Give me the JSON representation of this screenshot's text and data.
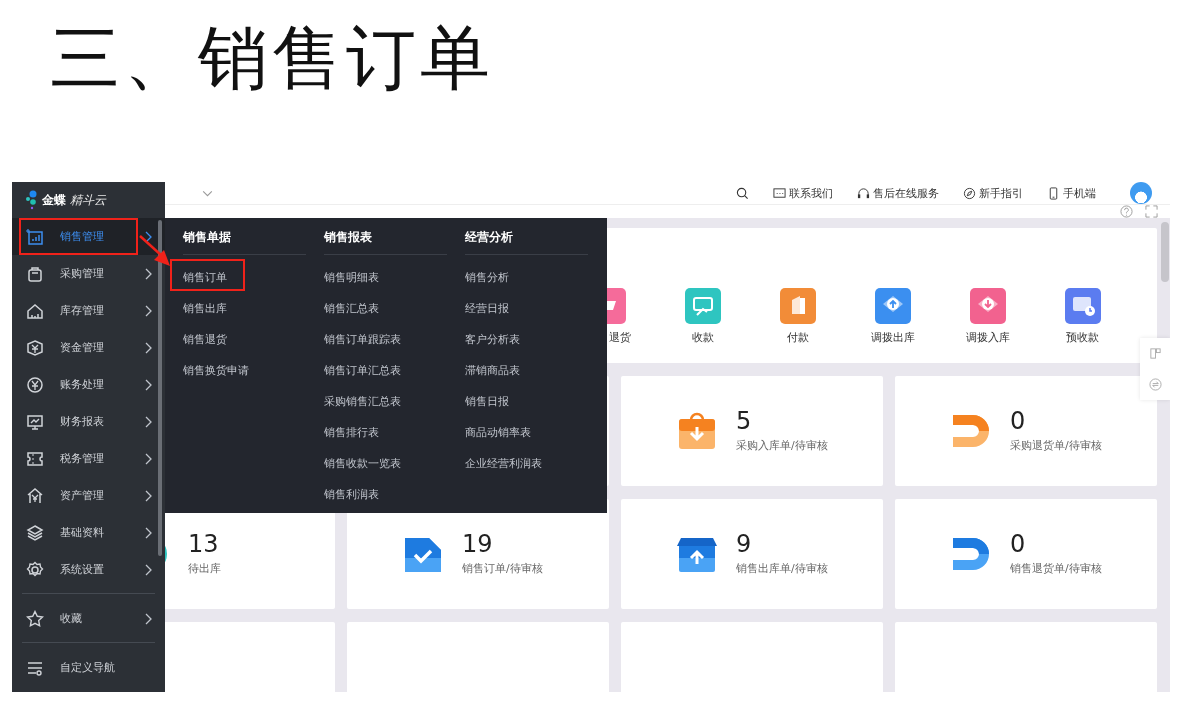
{
  "slide_title": "三、销售订单",
  "app": {
    "logo_brand": "金蝶",
    "logo_product": "精斗云",
    "header_links": [
      {
        "label": "联系我们"
      },
      {
        "label": "售后在线服务"
      },
      {
        "label": "新手指引"
      },
      {
        "label": "手机端"
      }
    ],
    "sidebar": {
      "items": [
        {
          "label": "销售管理",
          "selected": true,
          "annotated": true
        },
        {
          "label": "采购管理",
          "selected": false,
          "annotated": false
        },
        {
          "label": "库存管理",
          "selected": false,
          "annotated": false
        },
        {
          "label": "资金管理",
          "selected": false,
          "annotated": false
        },
        {
          "label": "账务处理",
          "selected": false,
          "annotated": false
        },
        {
          "label": "财务报表",
          "selected": false,
          "annotated": false
        },
        {
          "label": "税务管理",
          "selected": false,
          "annotated": false
        },
        {
          "label": "资产管理",
          "selected": false,
          "annotated": false
        },
        {
          "label": "基础资料",
          "selected": false,
          "annotated": false
        },
        {
          "label": "系统设置",
          "selected": false,
          "annotated": false
        }
      ],
      "favorites": {
        "label": "收藏"
      },
      "custom_nav": {
        "label": "自定义导航"
      }
    },
    "mega_menu": {
      "columns": [
        {
          "title": "销售单据",
          "items": [
            {
              "label": "销售订单",
              "annotated": true
            },
            {
              "label": "销售出库",
              "annotated": false
            },
            {
              "label": "销售退货",
              "annotated": false
            },
            {
              "label": "销售换货申请",
              "annotated": false
            }
          ]
        },
        {
          "title": "销售报表",
          "items": [
            {
              "label": "销售明细表",
              "annotated": false
            },
            {
              "label": "销售汇总表",
              "annotated": false
            },
            {
              "label": "销售订单跟踪表",
              "annotated": false
            },
            {
              "label": "销售订单汇总表",
              "annotated": false
            },
            {
              "label": "采购销售汇总表",
              "annotated": false
            },
            {
              "label": "销售排行表",
              "annotated": false
            },
            {
              "label": "销售收款一览表",
              "annotated": false
            },
            {
              "label": "销售利润表",
              "annotated": false
            }
          ]
        },
        {
          "title": "经营分析",
          "items": [
            {
              "label": "销售分析",
              "annotated": false
            },
            {
              "label": "经营日报",
              "annotated": false
            },
            {
              "label": "客户分析表",
              "annotated": false
            },
            {
              "label": "滞销商品表",
              "annotated": false
            },
            {
              "label": "销售日报",
              "annotated": false
            },
            {
              "label": "商品动销率表",
              "annotated": false
            },
            {
              "label": "企业经营利润表",
              "annotated": false
            }
          ]
        }
      ]
    },
    "quick_actions": [
      {
        "label": "退货"
      },
      {
        "label": "收款"
      },
      {
        "label": "付款"
      },
      {
        "label": "调拨出库"
      },
      {
        "label": "调拨入库"
      },
      {
        "label": "预收款"
      }
    ],
    "stat_cards": [
      {
        "count": "5",
        "label": "采购入库单/待审核"
      },
      {
        "count": "0",
        "label": "采购退货单/待审核"
      },
      {
        "count": "13",
        "label": "待出库"
      },
      {
        "count": "19",
        "label": "销售订单/待审核"
      },
      {
        "count": "9",
        "label": "销售出库单/待审核"
      },
      {
        "count": "0",
        "label": "销售退货单/待审核"
      }
    ]
  }
}
